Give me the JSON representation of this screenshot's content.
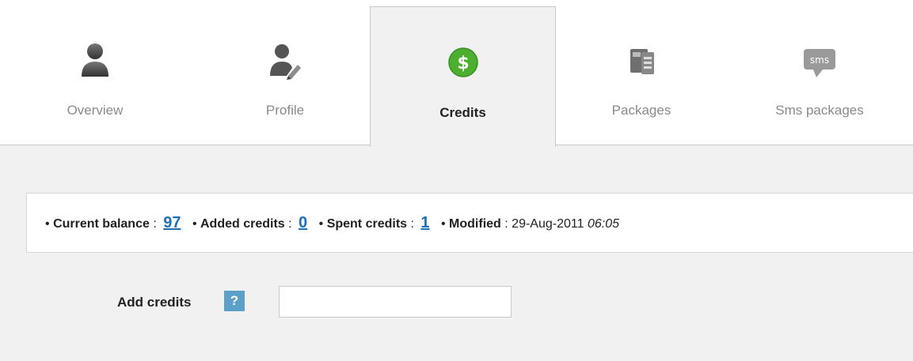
{
  "tabs": [
    {
      "label": "Overview",
      "icon": "user-icon"
    },
    {
      "label": "Profile",
      "icon": "user-edit-icon"
    },
    {
      "label": "Credits",
      "icon": "dollar-icon"
    },
    {
      "label": "Packages",
      "icon": "packages-icon"
    },
    {
      "label": "Sms packages",
      "icon": "sms-icon",
      "icon_text": "sms"
    }
  ],
  "active_tab": "Credits",
  "colors": {
    "accent_green": "#4caf2f",
    "link_blue": "#1f6fb5",
    "help_blue": "#5aa0c8"
  },
  "summary": {
    "bullet": "•",
    "balance_label": "Current balance",
    "balance_value": "97",
    "added_label": "Added credits",
    "added_value": "0",
    "spent_label": "Spent credits",
    "spent_value": "1",
    "modified_label": "Modified",
    "modified_date": "29-Aug-2011",
    "modified_time": "06:05",
    "colon": ":"
  },
  "add_credits": {
    "label": "Add credits",
    "help": "?",
    "value": "",
    "placeholder": ""
  }
}
